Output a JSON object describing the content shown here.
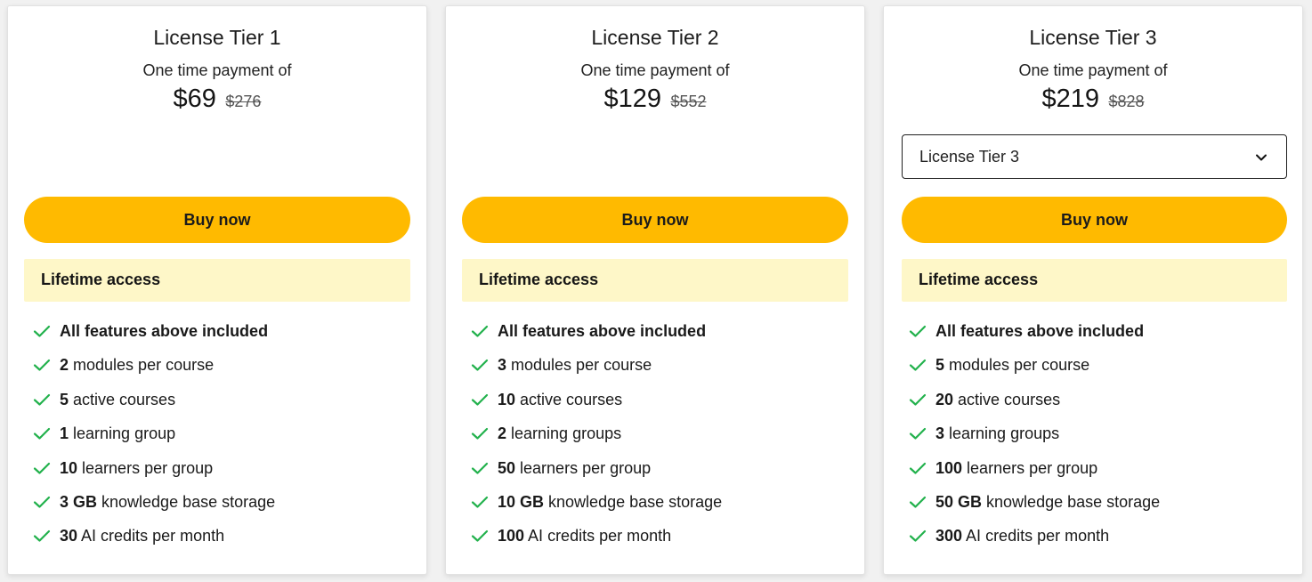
{
  "colors": {
    "accent_button": "#ffba00",
    "access_banner": "#fef7c8",
    "check": "#22b14c"
  },
  "tiers": [
    {
      "title": "License Tier 1",
      "payment_label": "One time payment of",
      "price": "$69",
      "old_price": "$276",
      "buy_label": "Buy now",
      "access_label": "Lifetime access",
      "features": [
        {
          "bold": "All features above included",
          "rest": ""
        },
        {
          "bold": "2",
          "rest": " modules per course"
        },
        {
          "bold": "5",
          "rest": " active courses"
        },
        {
          "bold": "1",
          "rest": " learning group"
        },
        {
          "bold": "10",
          "rest": " learners per group"
        },
        {
          "bold": "3 GB",
          "rest": " knowledge base storage"
        },
        {
          "bold": "30",
          "rest": " AI credits per month"
        }
      ]
    },
    {
      "title": "License Tier 2",
      "payment_label": "One time payment of",
      "price": "$129",
      "old_price": "$552",
      "buy_label": "Buy now",
      "access_label": "Lifetime access",
      "features": [
        {
          "bold": "All features above included",
          "rest": ""
        },
        {
          "bold": "3",
          "rest": " modules per course"
        },
        {
          "bold": "10",
          "rest": " active courses"
        },
        {
          "bold": "2",
          "rest": " learning groups"
        },
        {
          "bold": "50",
          "rest": " learners per group"
        },
        {
          "bold": "10 GB",
          "rest": " knowledge base storage"
        },
        {
          "bold": "100",
          "rest": " AI credits per month"
        }
      ]
    },
    {
      "title": "License Tier 3",
      "payment_label": "One time payment of",
      "price": "$219",
      "old_price": "$828",
      "select_value": "License Tier 3",
      "buy_label": "Buy now",
      "access_label": "Lifetime access",
      "features": [
        {
          "bold": "All features above included",
          "rest": ""
        },
        {
          "bold": "5",
          "rest": " modules per course"
        },
        {
          "bold": "20",
          "rest": " active courses"
        },
        {
          "bold": "3",
          "rest": " learning groups"
        },
        {
          "bold": "100",
          "rest": " learners per group"
        },
        {
          "bold": "50 GB",
          "rest": " knowledge base storage"
        },
        {
          "bold": "300",
          "rest": " AI credits per month"
        }
      ]
    }
  ]
}
